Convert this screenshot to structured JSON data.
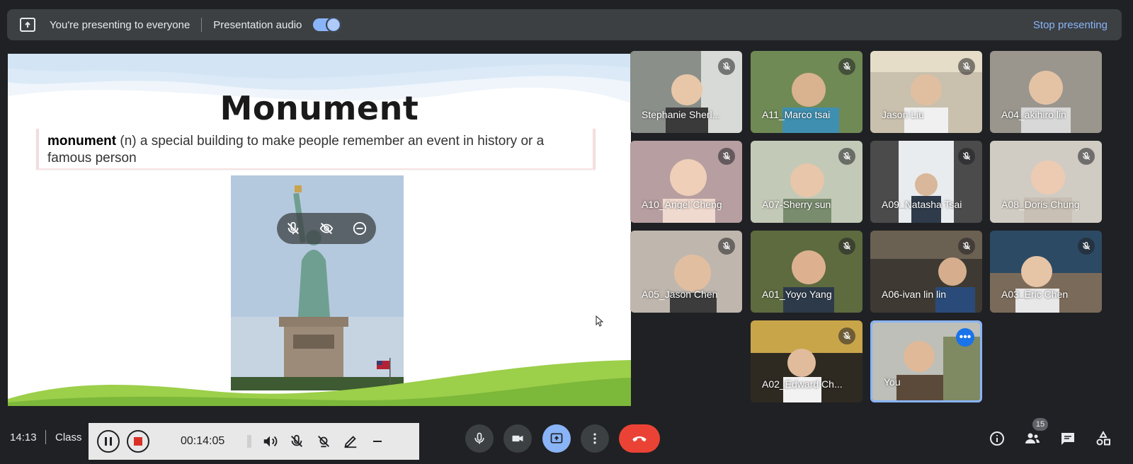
{
  "banner": {
    "presenting_text": "You're presenting to everyone",
    "audio_label": "Presentation audio",
    "audio_enabled": true,
    "stop_label": "Stop presenting"
  },
  "slide": {
    "title": "Monument",
    "definition_term": "monument",
    "definition_rest": " (n) a special building to make people remember an event in history or a famous person"
  },
  "participants": [
    {
      "name": "Stephanie Sherl...",
      "muted": true
    },
    {
      "name": "A11_Marco tsai",
      "muted": true
    },
    {
      "name": "Jason Liu",
      "muted": true
    },
    {
      "name": "A04_akihiro lin",
      "muted": false
    },
    {
      "name": "A10_Angel Cheng",
      "muted": true
    },
    {
      "name": "A07-Sherry sun",
      "muted": true
    },
    {
      "name": "A09_Natasha Tsai",
      "muted": true
    },
    {
      "name": "A08_Doris Chung",
      "muted": true
    },
    {
      "name": "A05_Jason Chen",
      "muted": true
    },
    {
      "name": "A01_Yoyo Yang",
      "muted": true
    },
    {
      "name": "A06-ivan lin lin",
      "muted": true
    },
    {
      "name": "A03_Eric Chen",
      "muted": true
    },
    {
      "name": "A02_Edward Ch...",
      "muted": true
    },
    {
      "name": "You",
      "muted": false
    }
  ],
  "bottom": {
    "clock": "14:13",
    "meeting_name": "Class",
    "recording_time": "00:14:05",
    "participant_count": "15"
  },
  "icons": {
    "present": "present-screen-icon",
    "mic": "mic-icon",
    "camera": "camera-icon",
    "more": "more-vert-icon",
    "end": "end-call-icon",
    "info": "info-icon",
    "people": "people-icon",
    "chat": "chat-icon",
    "activities": "activities-icon"
  },
  "colors": {
    "accent": "#8ab4f8",
    "end_call": "#ea4335",
    "background": "#202124",
    "tile": "#3c4043"
  }
}
